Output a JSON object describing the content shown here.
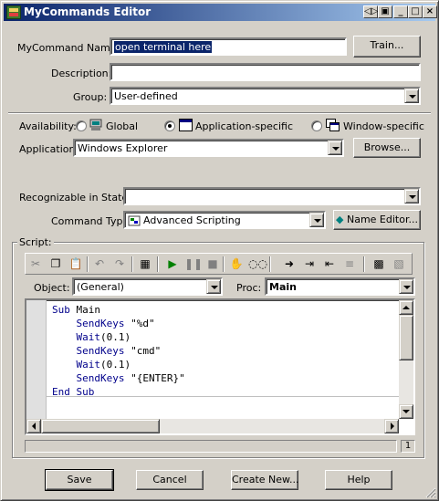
{
  "window": {
    "title": "MyCommands Editor"
  },
  "form": {
    "mycommand_name_label": "MyCommand Name:",
    "mycommand_name_value": "open terminal here",
    "train_label": "Train...",
    "description_label": "Description:",
    "description_value": "",
    "group_label": "Group:",
    "group_value": "User-defined",
    "availability_label": "Availability:",
    "availability_options": [
      "Global",
      "Application-specific",
      "Window-specific"
    ],
    "availability_selected": "Application-specific",
    "application_label": "Application:",
    "application_value": "Windows Explorer",
    "browse_label": "Browse...",
    "states_label": "Recognizable in States:",
    "states_value": "",
    "command_type_label": "Command Type:",
    "command_type_value": "Advanced Scripting",
    "name_editor_label": "Name Editor..."
  },
  "script": {
    "group_label": "Script:",
    "object_label": "Object:",
    "object_value": "(General)",
    "proc_label": "Proc:",
    "proc_value": "Main",
    "lines": [
      {
        "kw": "Sub",
        "rest": " Main"
      },
      {
        "kw": "    SendKeys",
        "rest": " \"%d\""
      },
      {
        "kw": "    Wait",
        "rest": "(0.1)"
      },
      {
        "kw": "    SendKeys",
        "rest": " \"cmd\""
      },
      {
        "kw": "    Wait",
        "rest": "(0.1)"
      },
      {
        "kw": "    SendKeys",
        "rest": " \"{ENTER}\""
      },
      {
        "kw": "End Sub",
        "rest": ""
      }
    ],
    "status_page": "1"
  },
  "footer": {
    "save_label": "Save",
    "cancel_label": "Cancel",
    "create_new_label": "Create New...",
    "help_label": "Help"
  },
  "colors": {
    "title_start": "#0a246a",
    "title_end": "#a6caf0",
    "face": "#d4d0c8",
    "keyword": "#00008b",
    "run_green": "#008000"
  }
}
